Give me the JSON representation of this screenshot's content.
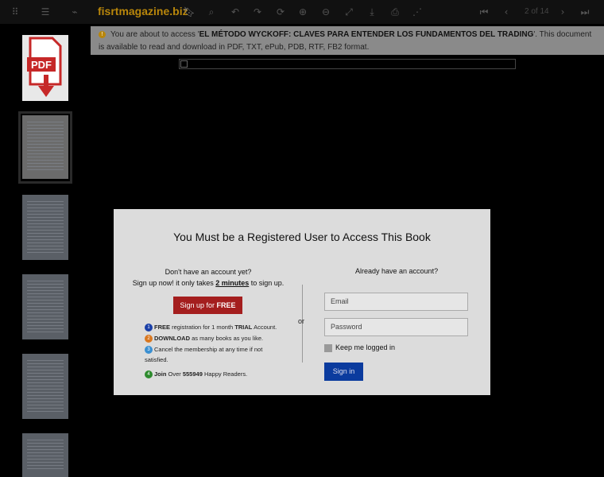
{
  "toolbar": {
    "site_title": "fisrtmagazine.biz",
    "page_counter": "2 of 14"
  },
  "notice": {
    "before": "You are about to access '",
    "book_title": "EL MÉTODO WYCKOFF: CLAVES PARA ENTENDER LOS FUNDAMENTOS DEL TRADING",
    "after": "'. This document is available to read and download in PDF, TXT, ePub, PDB, RTF, FB2 format."
  },
  "thumbnails": {
    "pdf_label": "PDF"
  },
  "modal": {
    "title": "You Must be a Registered User to Access This Book",
    "left": {
      "line1": "Don't have an account yet?",
      "line2_prefix": "Sign up now! it only takes ",
      "line2_bold": "2 minutes",
      "line2_suffix": " to sign up.",
      "signup_prefix": "Sign up for ",
      "signup_bold": "FREE",
      "features": [
        {
          "num": "1",
          "color": "#1a3fa8",
          "bold": "FREE",
          "text": " registration for 1 month ",
          "bold2": "TRIAL",
          "text2": " Account."
        },
        {
          "num": "2",
          "color": "#d9771f",
          "bold": "DOWNLOAD",
          "text": " as many books as you like.",
          "bold2": "",
          "text2": ""
        },
        {
          "num": "3",
          "color": "#3a8fd1",
          "bold": "",
          "text": "Cancel the membership at any time if not satisfied.",
          "bold2": "",
          "text2": ""
        },
        {
          "num": "4",
          "color": "#2e8b2e",
          "bold": "Join",
          "text": " Over ",
          "bold2": "555949",
          "text2": " Happy Readers."
        }
      ]
    },
    "or_label": "or",
    "right": {
      "title": "Already have an account?",
      "email_placeholder": "Email",
      "password_placeholder": "Password",
      "keep_logged_in": "Keep me logged in",
      "signin_label": "Sign in"
    }
  }
}
